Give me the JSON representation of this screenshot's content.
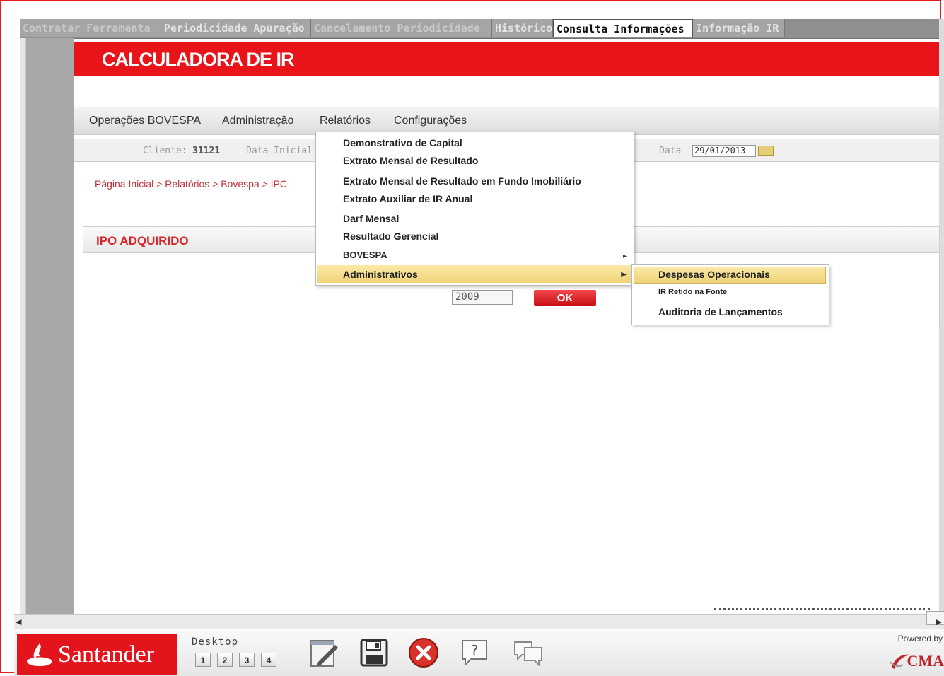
{
  "tabs": [
    {
      "label": "Contratar Ferramenta",
      "state": "inactive"
    },
    {
      "label": "Periodicidade Apuração",
      "state": "dim"
    },
    {
      "label": "Cancelamento Periodicidade",
      "state": "inactive"
    },
    {
      "label": "Histórico",
      "state": "dim"
    },
    {
      "label": "Consulta Informações",
      "state": "active"
    },
    {
      "label": "Informação IR",
      "state": "dim"
    }
  ],
  "banner": {
    "title": "CALCULADORA DE IR"
  },
  "menu": {
    "items": [
      "Operações BOVESPA",
      "Administração",
      "Relatórios",
      "Configurações"
    ]
  },
  "info": {
    "cliente_label": "Cliente:",
    "cliente_value": "31121",
    "data_inicial_label": "Data Inicial",
    "data_label": "Data",
    "data_value": "29/01/2013"
  },
  "breadcrumb": "Página Inicial > Relatórios > Bovespa > IPC",
  "panel": {
    "title": "IPO ADQUIRIDO",
    "year_value": "2009",
    "ok_label": "OK"
  },
  "dropdown": {
    "items": [
      {
        "label": "Demonstrativo de Capital",
        "has_submenu": false
      },
      {
        "label": "Extrato Mensal de Resultado",
        "has_submenu": false
      },
      {
        "label": "Extrato Mensal de Resultado em Fundo Imobiliário",
        "has_submenu": false
      },
      {
        "label": "Extrato Auxiliar de IR Anual",
        "has_submenu": false
      },
      {
        "label": "Darf Mensal",
        "has_submenu": false
      },
      {
        "label": "Resultado Gerencial",
        "has_submenu": false
      },
      {
        "label": "BOVESPA",
        "has_submenu": true
      },
      {
        "label": "Administrativos",
        "has_submenu": true,
        "highlighted": true
      }
    ]
  },
  "submenu": {
    "items": [
      {
        "label": "Despesas Operacionais",
        "highlighted": true
      },
      {
        "label": "IR Retido na Fonte"
      },
      {
        "label": "Auditoria de Lançamentos"
      }
    ]
  },
  "bottombar": {
    "brand": "Santander",
    "desktop_label": "Desktop",
    "desktops": [
      "1",
      "2",
      "3",
      "4"
    ],
    "tools": [
      "edit-icon",
      "save-icon",
      "close-icon",
      "help-icon",
      "chat-icon"
    ],
    "powered_by": "Powered by",
    "powered_brand": "CMA"
  },
  "colors": {
    "brand_red": "#e8141a",
    "highlight": "#f0d379",
    "link_red": "#c0303a"
  }
}
